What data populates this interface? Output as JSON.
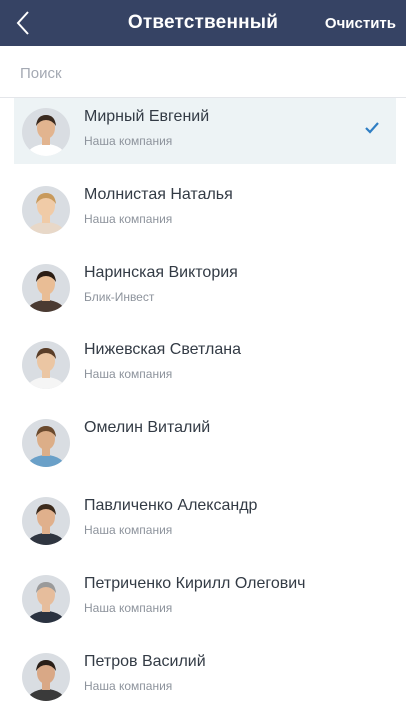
{
  "header": {
    "title": "Ответственный",
    "clear_label": "Очистить",
    "background": "#364364"
  },
  "search": {
    "placeholder": "Поиск",
    "value": ""
  },
  "contacts": [
    {
      "name": "Мирный Евгений",
      "company": "Наша компания",
      "selected": true,
      "skin": "#e2b48f",
      "hair": "#3a2a1f",
      "shirt": "#ffffff"
    },
    {
      "name": "Молнистая Наталья",
      "company": "Наша компания",
      "selected": false,
      "skin": "#f0cba7",
      "hair": "#c89a5c",
      "shirt": "#e8d8c8"
    },
    {
      "name": "Наринская Виктория",
      "company": "Блик-Инвест",
      "selected": false,
      "skin": "#e9bd95",
      "hair": "#2b1d14",
      "shirt": "#4a3a32"
    },
    {
      "name": "Нижевская Светлана",
      "company": "Наша компания",
      "selected": false,
      "skin": "#ebc6a3",
      "hair": "#5a3e28",
      "shirt": "#f5f5f5"
    },
    {
      "name": "Омелин Виталий",
      "company": "",
      "selected": false,
      "skin": "#dcae88",
      "hair": "#6b4a2e",
      "shirt": "#6aa0c8"
    },
    {
      "name": "Павличенко Александр",
      "company": "Наша компания",
      "selected": false,
      "skin": "#e0b08c",
      "hair": "#3b2a1c",
      "shirt": "#2f3540"
    },
    {
      "name": "Петриченко Кирилл Олегович",
      "company": "Наша компания",
      "selected": false,
      "skin": "#e6bd9c",
      "hair": "#9a9a9a",
      "shirt": "#2a3240"
    },
    {
      "name": "Петров Василий",
      "company": "Наша компания",
      "selected": false,
      "skin": "#d9a886",
      "hair": "#2a1f18",
      "shirt": "#3a3a3a"
    }
  ],
  "colors": {
    "selected_row": "#edf3f5",
    "check": "#2f7ec4"
  },
  "icons": {
    "back": "chevron-left-icon",
    "check": "check-icon"
  }
}
